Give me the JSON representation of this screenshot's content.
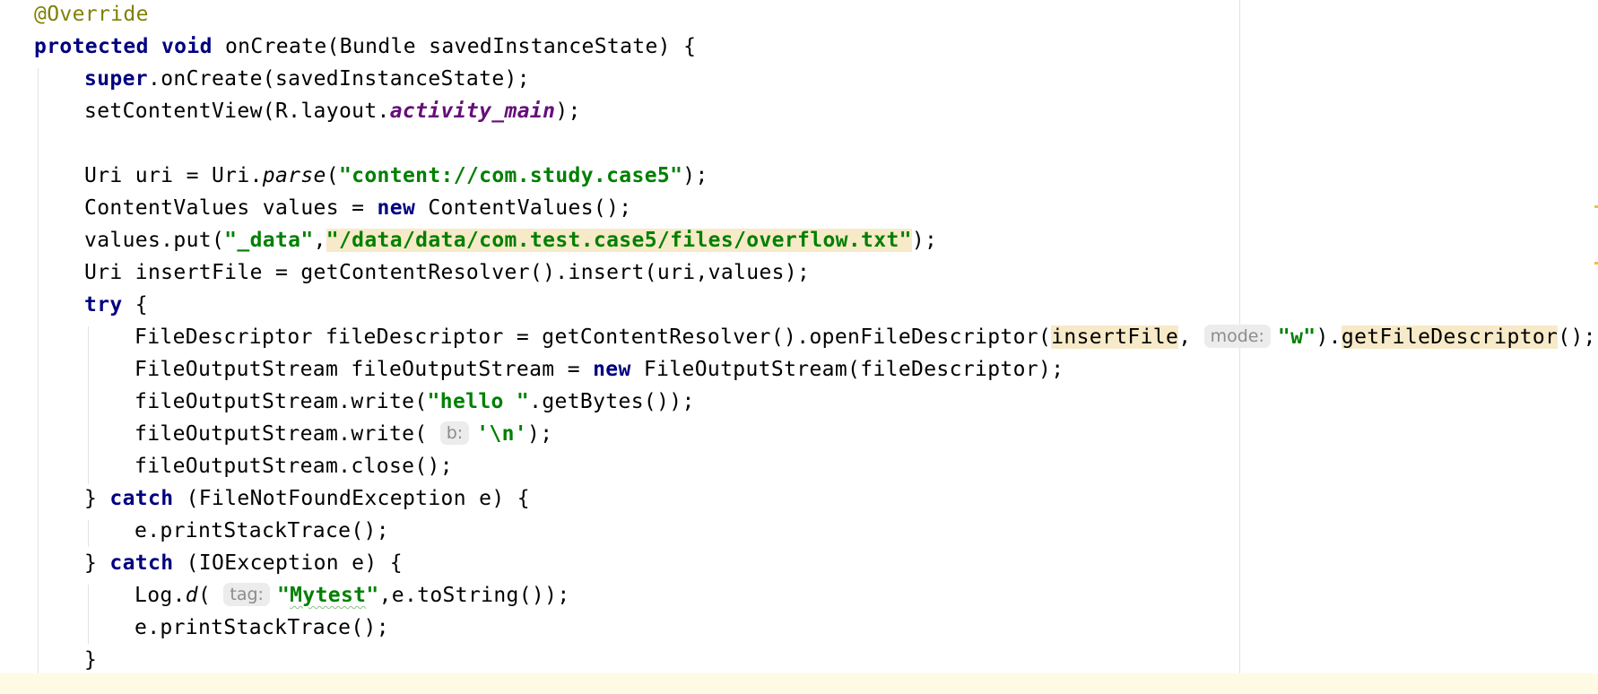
{
  "editor": {
    "language": "java",
    "colors": {
      "keyword": "#000080",
      "annotation": "#808000",
      "string": "#008000",
      "field": "#660e7a",
      "current_line": "#fffae3",
      "usage_highlight": "#f7eac8"
    },
    "lines": {
      "l1": {
        "t0": "@Override"
      },
      "l2": {
        "t0": "protected",
        "t1": " ",
        "t2": "void",
        "t3": " onCreate(Bundle savedInstanceState) {"
      },
      "l3": {
        "t0": "super",
        "t1": ".onCreate(savedInstanceState);"
      },
      "l4": {
        "t0": "setContentView(R.layout.",
        "t1": "activity_main",
        "t2": ");"
      },
      "l6": {
        "t0": "Uri uri = Uri.",
        "t1": "parse",
        "t2": "(",
        "t3": "\"content://com.study.case5\"",
        "t4": ");"
      },
      "l7": {
        "t0": "ContentValues values = ",
        "t1": "new",
        "t2": " ContentValues();"
      },
      "l8": {
        "t0": "values.put(",
        "t1": "\"_data\"",
        "t2": ",",
        "t3": "\"/data/data/com.test.case5/files/overflow.txt\"",
        "t4": ");"
      },
      "l9": {
        "t0": "Uri insertFile = getContentResolver().insert(uri,values);"
      },
      "l10": {
        "t0": "try",
        "t1": " {"
      },
      "l11": {
        "t0": "FileDescriptor fileDescriptor = getContentResolver().openFileDescriptor(",
        "t1": "insertFile",
        "t2": ", ",
        "hint": "mode:",
        "t3": "\"w\"",
        "t4": ").",
        "t5": "getFileDescriptor",
        "t6": "();"
      },
      "l12": {
        "t0": "FileOutputStream fileOutputStream = ",
        "t1": "new",
        "t2": " FileOutputStream(fileDescriptor);"
      },
      "l13": {
        "t0": "fileOutputStream.write(",
        "t1": "\"hello \"",
        "t2": ".getBytes());"
      },
      "l14": {
        "t0": "fileOutputStream.write( ",
        "hint": "b:",
        "t1": "'\\n'",
        "t2": ");"
      },
      "l15": {
        "t0": "fileOutputStream.close();"
      },
      "l16": {
        "t0": "} ",
        "t1": "catch",
        "t2": " (FileNotFoundException e) {"
      },
      "l17": {
        "t0": "e.printStackTrace();"
      },
      "l18": {
        "t0": "} ",
        "t1": "catch",
        "t2": " (IOException e) {"
      },
      "l19": {
        "t0": "Log.",
        "t1": "d",
        "t2": "( ",
        "hint": "tag:",
        "t3": "\"",
        "t4": "Mytest",
        "t5": "\"",
        "t6": ",e.toString());"
      },
      "l20": {
        "t0": "e.printStackTrace();"
      },
      "l21": {
        "t0": "}"
      }
    }
  }
}
